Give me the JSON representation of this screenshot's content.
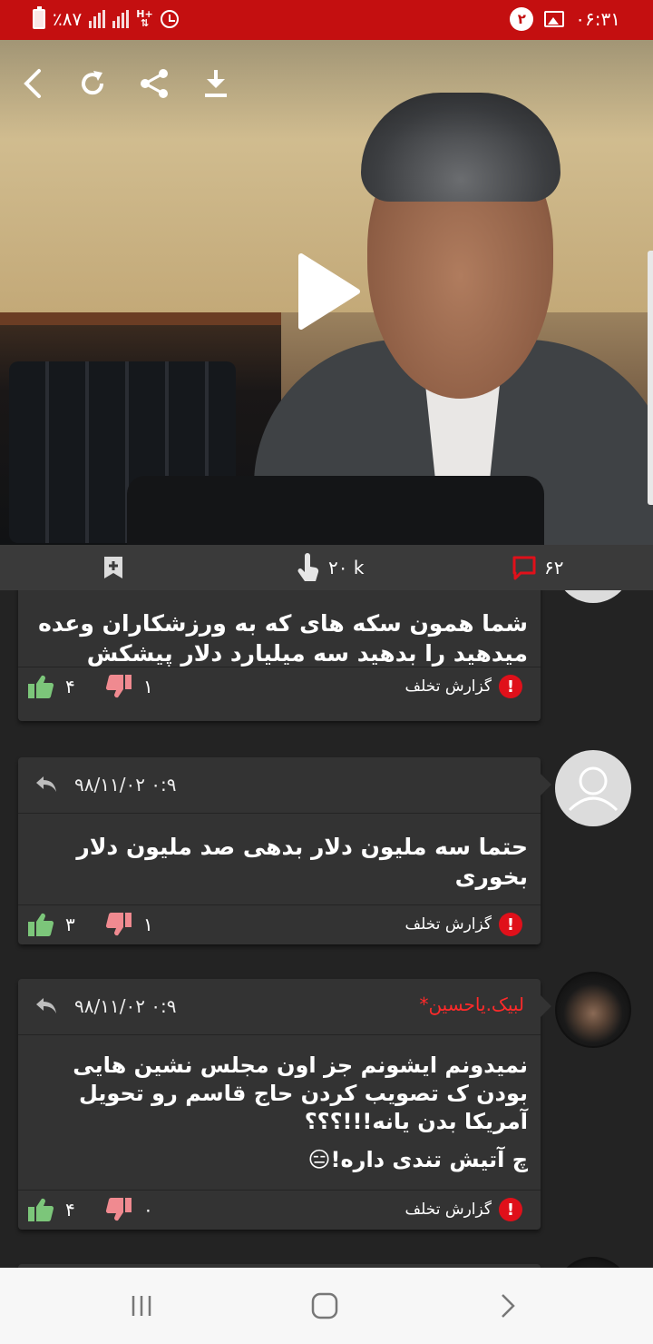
{
  "status_bar": {
    "battery": "٪۸۷",
    "network": "H+",
    "notification_count": "۲",
    "time": "۰۶:۳۱",
    "color": "#c40f10"
  },
  "video": {
    "icons": [
      "back-icon",
      "refresh-icon",
      "share-icon",
      "download-icon",
      "play-icon"
    ]
  },
  "stats": {
    "views": "۲۰ k",
    "comments": "۶۲"
  },
  "comments": [
    {
      "author": "",
      "date": "",
      "body": "شما همون سکه های که به ورزشکاران وعده میدهید را بدهید سه میلیارد دلار پیشکش",
      "likes": "۴",
      "dislikes": "۱",
      "report_label": "گزارش تخلف"
    },
    {
      "author": "",
      "date": "۹۸/۱۱/۰۲ ۰:۹",
      "body": "حتما سه ملیون دلار بدهی صد ملیون دلار بخوری",
      "likes": "۳",
      "dislikes": "۱",
      "report_label": "گزارش تخلف"
    },
    {
      "author": "لبیک.یاحسین*",
      "date": "۹۸/۱۱/۰۲ ۰:۹",
      "body": "نمیدونم ایشونم جز اون مجلس نشین هایی بودن ک تصویب کردن حاج قاسم رو تحویل آمریکا بدن یانه!!!؟؟؟",
      "body2": "چ آتیش تندی داره!😑",
      "likes": "۴",
      "dislikes": "۰",
      "report_label": "گزارش تخلف"
    }
  ],
  "colors": {
    "accent_red": "#e0101a",
    "like_green": "#7cc67a",
    "dislike_pink": "#f08a90",
    "card_bg": "#333333",
    "page_bg": "#232323"
  }
}
